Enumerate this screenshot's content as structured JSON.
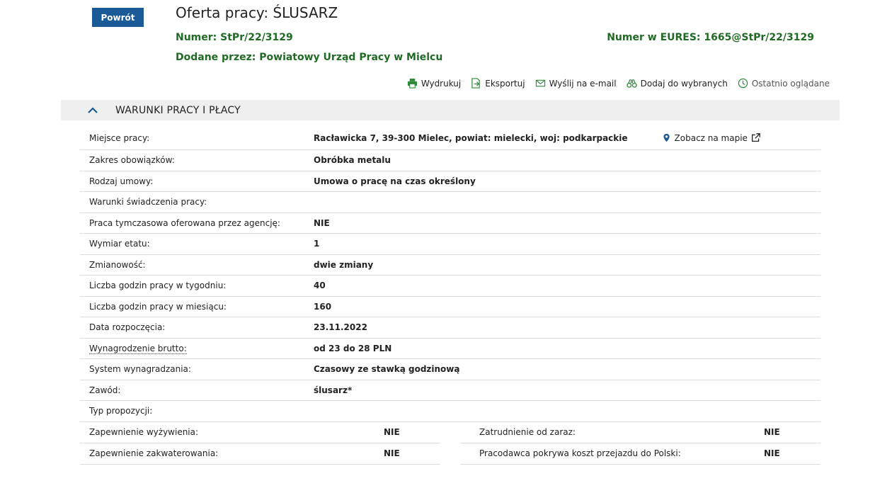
{
  "header": {
    "back_label": "Powrót",
    "title": "Oferta pracy: ŚLUSARZ",
    "number_label": "Numer:",
    "number_value": "StPr/22/3129",
    "added_label": "Dodane przez:",
    "added_value": "Powiatowy Urząd Pracy w Mielcu",
    "eures_label": "Numer w EURES:",
    "eures_value": "1665@StPr/22/3129"
  },
  "actions": {
    "print": "Wydrukuj",
    "export": "Eksportuj",
    "email": "Wyślij na e-mail",
    "favorite": "Dodaj do wybranych",
    "recent": "Ostatnio oglądane"
  },
  "section": {
    "title": "WARUNKI PRACY I PŁACY",
    "map_link": "Zobacz na mapie",
    "rows": [
      {
        "label": "Miejsce pracy:",
        "value": "Racławicka 7, 39-300 Mielec, powiat: mielecki, woj: podkarpackie"
      },
      {
        "label": "Zakres obowiązków:",
        "value": "Obróbka metalu"
      },
      {
        "label": "Rodzaj umowy:",
        "value": "Umowa o pracę na czas określony"
      },
      {
        "label": "Warunki świadczenia pracy:",
        "value": ""
      },
      {
        "label": "Praca tymczasowa oferowana przez agencję:",
        "value": "NIE"
      },
      {
        "label": "Wymiar etatu:",
        "value": "1"
      },
      {
        "label": "Zmianowość:",
        "value": "dwie zmiany"
      },
      {
        "label": "Liczba godzin pracy w tygodniu:",
        "value": "40"
      },
      {
        "label": "Liczba godzin pracy w miesiącu:",
        "value": "160"
      },
      {
        "label": "Data rozpoczęcia:",
        "value": "23.11.2022"
      },
      {
        "label": "Wynagrodzenie brutto:",
        "value": "od 23 do 28 PLN"
      },
      {
        "label": "System wynagradzania:",
        "value": "Czasowy ze stawką godzinową"
      },
      {
        "label": "Zawód:",
        "value": "ślusarz*"
      },
      {
        "label": "Typ propozycji:",
        "value": ""
      }
    ],
    "split_rows": [
      {
        "left_label": "Zapewnienie wyżywienia:",
        "left_value": "NIE",
        "right_label": "Zatrudnienie od zaraz:",
        "right_value": "NIE"
      },
      {
        "left_label": "Zapewnienie zakwaterowania:",
        "left_value": "NIE",
        "right_label": "Pracodawca pokrywa koszt przejazdu do Polski:",
        "right_value": "NIE"
      }
    ]
  },
  "colors": {
    "primary": "#1a5a96",
    "green_text": "#1f6b24",
    "section_bg": "#efefef",
    "icon_green": "#2e8a3a",
    "map_pin": "#1a5a96"
  }
}
